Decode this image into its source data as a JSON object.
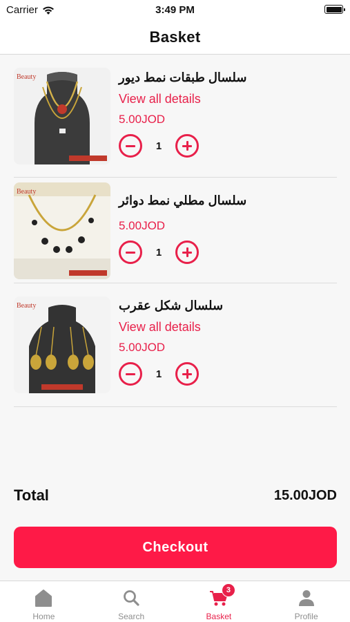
{
  "status_bar": {
    "carrier": "Carrier",
    "time": "3:49 PM"
  },
  "nav": {
    "title": "Basket"
  },
  "cart": {
    "items": [
      {
        "name": "سلسال طبقات نمط ديور",
        "details_link": "View all details",
        "price": "5.00JOD",
        "quantity": "1"
      },
      {
        "name": "سلسال مطلي نمط دوائر",
        "details_link": "",
        "price": "5.00JOD",
        "quantity": "1"
      },
      {
        "name": "سلسال شكل عقرب",
        "details_link": "View all details",
        "price": "5.00JOD",
        "quantity": "1"
      }
    ]
  },
  "total": {
    "label": "Total",
    "value": "15.00JOD"
  },
  "checkout": {
    "label": "Checkout"
  },
  "tabs": [
    {
      "label": "Home",
      "icon": "home-icon"
    },
    {
      "label": "Search",
      "icon": "search-icon"
    },
    {
      "label": "Basket",
      "icon": "cart-icon",
      "badge": "3"
    },
    {
      "label": "Profile",
      "icon": "profile-icon"
    }
  ],
  "colors": {
    "accent": "#e8204a",
    "button": "#fe1a47",
    "inactive": "#8e8e8e"
  }
}
